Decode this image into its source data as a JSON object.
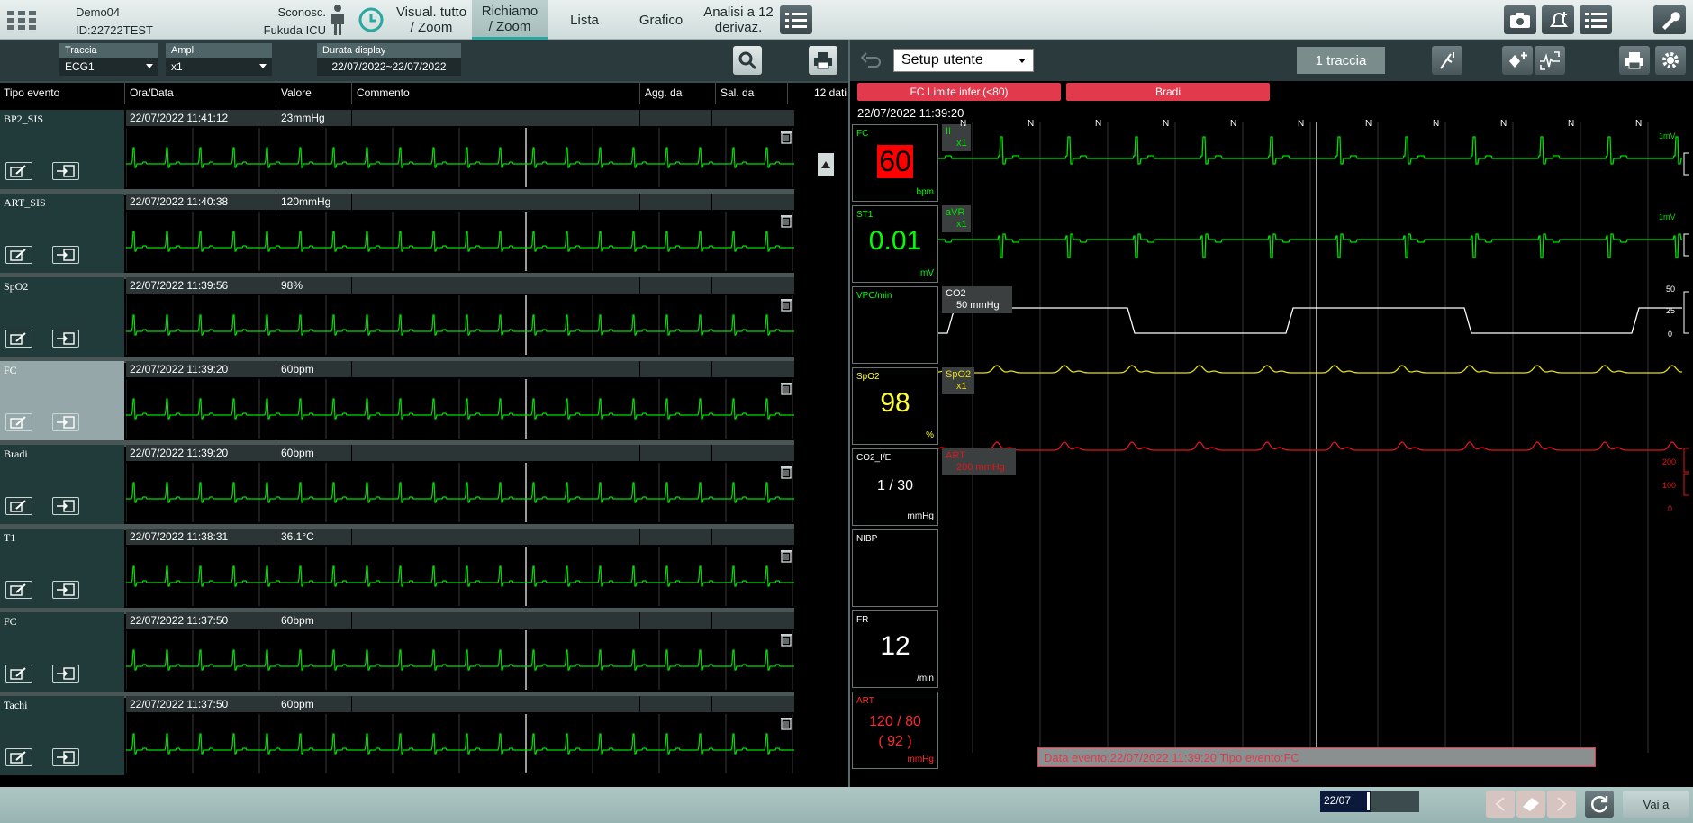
{
  "patient": {
    "name": "Demo04",
    "id": "ID:22722TEST",
    "location_line1": "Sconosc.",
    "location_line2": "Fukuda ICU"
  },
  "top_tabs": [
    {
      "label_l1": "Visual. tutto",
      "label_l2": "/ Zoom"
    },
    {
      "label_l1": "Richiamo",
      "label_l2": "/ Zoom"
    },
    {
      "label_l1": "Lista",
      "label_l2": ""
    },
    {
      "label_l1": "Grafico",
      "label_l2": ""
    },
    {
      "label_l1": "Analisi a 12",
      "label_l2": "derivaz."
    }
  ],
  "filters": {
    "traccia": {
      "label": "Traccia",
      "value": "ECG1"
    },
    "ampl": {
      "label": "Ampl.",
      "value": "x1"
    },
    "durata": {
      "label": "Durata display",
      "value": "22/07/2022~22/07/2022"
    }
  },
  "columns": [
    "Tipo evento",
    "Ora/Data",
    "Valore",
    "Commento",
    "Agg. da",
    "Sal. da",
    "12 dati"
  ],
  "events": [
    {
      "type": "BP2_SIS",
      "time": "22/07/2022 11:41:12",
      "value": "23mmHg",
      "selected": false
    },
    {
      "type": "ART_SIS",
      "time": "22/07/2022 11:40:38",
      "value": "120mmHg",
      "selected": false
    },
    {
      "type": "SpO2",
      "time": "22/07/2022 11:39:56",
      "value": "98%",
      "selected": false
    },
    {
      "type": "FC",
      "time": "22/07/2022 11:39:20",
      "value": "60bpm",
      "selected": true
    },
    {
      "type": "Bradi",
      "time": "22/07/2022 11:39:20",
      "value": "60bpm",
      "selected": false
    },
    {
      "type": "T1",
      "time": "22/07/2022 11:38:31",
      "value": "36.1°C",
      "selected": false
    },
    {
      "type": "FC",
      "time": "22/07/2022 11:37:50",
      "value": "60bpm",
      "selected": false
    },
    {
      "type": "Tachi",
      "time": "22/07/2022 11:37:50",
      "value": "60bpm",
      "selected": false
    }
  ],
  "right_toolbar": {
    "setup_label": "Setup utente",
    "traccia_btn": "1 traccia"
  },
  "alarms": [
    "FC Limite infer.(<80)",
    "Bradi"
  ],
  "event_time": "22/07/2022 11:39:20",
  "params": [
    {
      "label": "FC",
      "value": "60",
      "unit": "bpm",
      "color": "#00ff00",
      "value_color": "#ff2b2b"
    },
    {
      "label": "ST1",
      "value": "0.01",
      "unit": "mV",
      "color": "#00ff00",
      "value_color": "#00ff00"
    },
    {
      "label": "VPC/min",
      "value": "",
      "unit": "",
      "color": "#00ff00",
      "value_color": "#00ff00"
    },
    {
      "label": "SpO2",
      "value": "98",
      "unit": "%",
      "color": "#ffff33",
      "value_color": "#ffff33"
    },
    {
      "label": "CO2_I/E",
      "value": "1 / 30",
      "unit": "mmHg",
      "color": "#ffffff",
      "value_color": "#ffffff"
    },
    {
      "label": "NIBP",
      "value": "",
      "unit": "",
      "color": "#ffffff",
      "value_color": "#ffffff"
    },
    {
      "label": "FR",
      "value": "12",
      "unit": "/min",
      "color": "#ffffff",
      "value_color": "#ffffff"
    },
    {
      "label": "ART",
      "value": "120 / 80",
      "value2": "( 92 )",
      "unit": "mmHg",
      "color": "#ff2b2b",
      "value_color": "#ff2b2b"
    }
  ],
  "waves": {
    "ecg2_label": "II",
    "ecg2_gain": "x1",
    "ecg3_label": "aVR",
    "ecg3_gain": "x1",
    "co2_label": "CO2",
    "co2_scale": "50 mmHg",
    "spo2_label": "SpO2",
    "spo2_gain": "x1",
    "art_label": "ART",
    "art_scale": "200 mmHg",
    "ecg_scale": "1mV",
    "co2_ticks": [
      "50",
      "25",
      "0"
    ],
    "art_ticks": [
      "200",
      "100",
      "0"
    ],
    "beat_marker": "N"
  },
  "event_banner": "Data evento:22/07/2022 11:39:20   Tipo evento:FC",
  "bottom": {
    "date": "22/07",
    "go_label": "Vai a"
  },
  "colors": {
    "ecg": "#00e000",
    "co2": "#ffffff",
    "spo2": "#e6dd1a",
    "art": "#e01818",
    "alarm": "#e2394d"
  }
}
